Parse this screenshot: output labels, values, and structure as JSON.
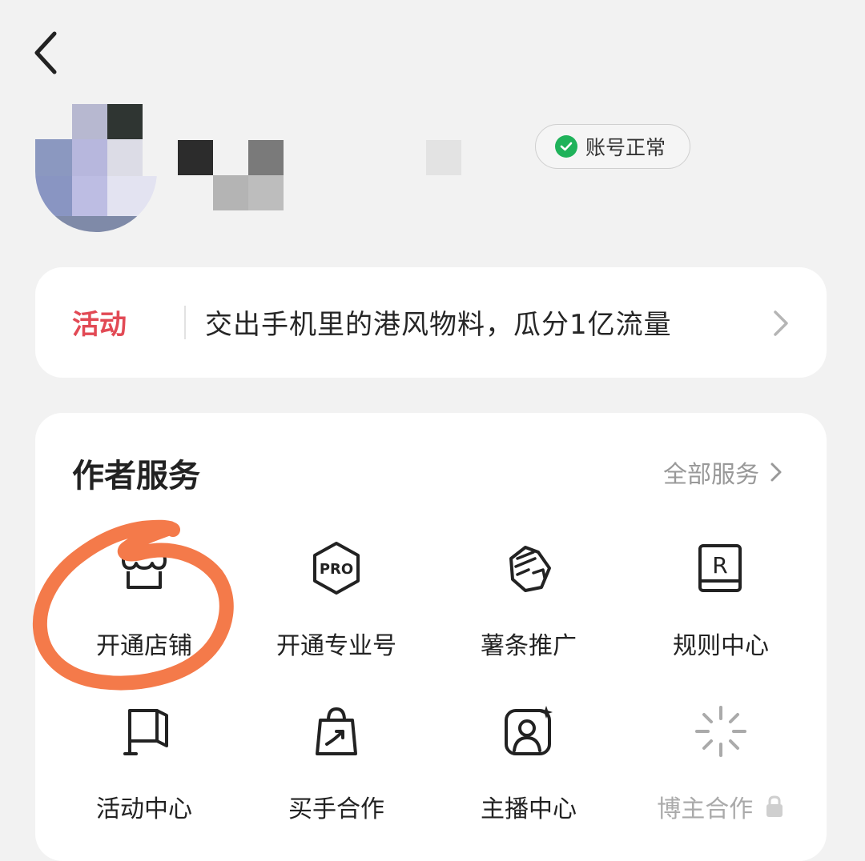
{
  "header": {
    "status_badge": "账号正常"
  },
  "activity": {
    "tag": "活动",
    "text": "交出手机里的港风物料，瓜分1亿流量"
  },
  "services": {
    "title": "作者服务",
    "all_label": "全部服务",
    "items": [
      {
        "label": "开通店铺",
        "icon": "shop-icon"
      },
      {
        "label": "开通专业号",
        "icon": "pro-badge-icon"
      },
      {
        "label": "薯条推广",
        "icon": "fist-promotion-icon"
      },
      {
        "label": "规则中心",
        "icon": "rulebook-icon"
      },
      {
        "label": "活动中心",
        "icon": "flag-icon"
      },
      {
        "label": "买手合作",
        "icon": "shopping-bag-icon"
      },
      {
        "label": "主播中心",
        "icon": "streamer-icon"
      },
      {
        "label": "博主合作",
        "icon": "sparkle-icon",
        "locked": true
      }
    ]
  },
  "colors": {
    "background": "#f2f2f2",
    "activity_tag": "#e24a55",
    "status_ok": "#1fb25a",
    "annotation": "#f47a4a"
  }
}
